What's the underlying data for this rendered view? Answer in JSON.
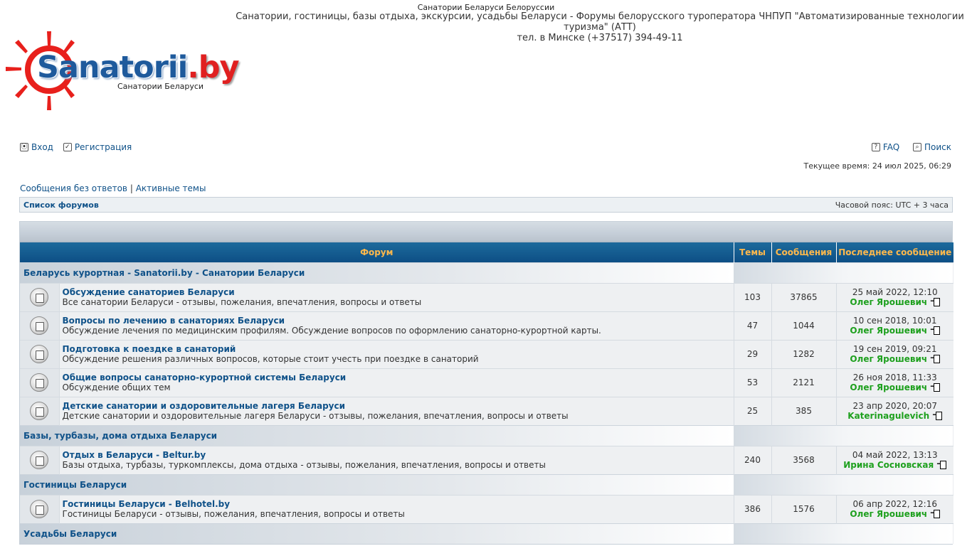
{
  "header": {
    "tagline": "Санатории Беларуси Белоруссии",
    "description": "Санатории, гостиницы, базы отдыха, экскурсии, усадьбы Беларуси - Форумы белорусского туроператора ЧНПУП \"Автоматизированные технологии туризма\" (АТТ)",
    "phone": "тел. в Минске (+37517) 394-49-11",
    "logo_main": "Sanatorii",
    "logo_tld": ".by",
    "logo_sub": "Санатории Беларуси"
  },
  "nav": {
    "login": "Вход",
    "register": "Регистрация",
    "faq": "FAQ",
    "search": "Поиск"
  },
  "current_time": "Текущее время: 24 июл 2025, 06:29",
  "quicklinks": {
    "unanswered": "Сообщения без ответов",
    "separator": "|",
    "active": "Активные темы"
  },
  "breadcrumb": {
    "forum_list": "Список форумов",
    "timezone": "Часовой пояс: UTC + 3 часа"
  },
  "table": {
    "col_forum": "Форум",
    "col_topics": "Темы",
    "col_posts": "Сообщения",
    "col_last": "Последнее сообщение"
  },
  "categories": [
    {
      "title": "Беларусь курортная - Sanatorii.by - Санатории Беларуси",
      "forums": [
        {
          "title": "Обсуждение санаториев Беларуси",
          "desc": "Все санатории Беларуси - отзывы, пожелания, впечатления, вопросы и ответы",
          "topics": "103",
          "posts": "37865",
          "last_date": "25 май 2022, 12:10",
          "last_user": "Олег Ярошевич"
        },
        {
          "title": "Вопросы по лечению в санаториях Беларуси",
          "desc": "Обсуждение лечения по медицинским профилям. Обсуждение вопросов по оформлению санаторно-курортной карты.",
          "topics": "47",
          "posts": "1044",
          "last_date": "10 сен 2018, 10:01",
          "last_user": "Олег Ярошевич"
        },
        {
          "title": "Подготовка к поездке в санаторий",
          "desc": "Обсуждение решения различных вопросов, которые стоит учесть при поездке в санаторий",
          "topics": "29",
          "posts": "1282",
          "last_date": "19 сен 2019, 09:21",
          "last_user": "Олег Ярошевич"
        },
        {
          "title": "Общие вопросы санаторно-курортной системы Беларуси",
          "desc": "Обсуждение общих тем",
          "topics": "53",
          "posts": "2121",
          "last_date": "26 ноя 2018, 11:33",
          "last_user": "Олег Ярошевич"
        },
        {
          "title": "Детские санатории и оздоровительные лагеря Беларуси",
          "desc": "Детские санатории и оздоровительные лагеря Беларуси - отзывы, пожелания, впечатления, вопросы и ответы",
          "topics": "25",
          "posts": "385",
          "last_date": "23 апр 2020, 20:07",
          "last_user": "Katerinagulevich"
        }
      ]
    },
    {
      "title": "Базы, турбазы, дома отдыха Беларуси",
      "forums": [
        {
          "title": "Отдых в Беларуси - Beltur.by",
          "desc": "Базы отдыха, турбазы, туркомплексы, дома отдыха - отзывы, пожелания, впечатления, вопросы и ответы",
          "topics": "240",
          "posts": "3568",
          "last_date": "04 май 2022, 13:13",
          "last_user": "Ирина Сосновская"
        }
      ]
    },
    {
      "title": "Гостиницы Беларуси",
      "forums": [
        {
          "title": "Гостиницы Беларуси - Belhotel.by",
          "desc": "Гостиницы Беларуси - отзывы, пожелания, впечатления, вопросы и ответы",
          "topics": "386",
          "posts": "1576",
          "last_date": "06 апр 2022, 12:16",
          "last_user": "Олег Ярошевич"
        }
      ]
    },
    {
      "title": "Усадьбы Беларуси",
      "forums": []
    }
  ]
}
